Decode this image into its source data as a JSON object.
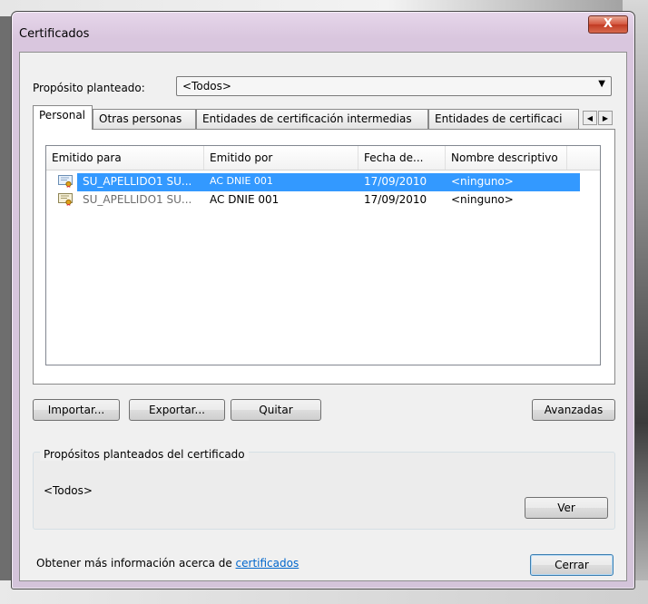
{
  "window": {
    "title": "Certificados",
    "close_glyph": "X"
  },
  "purpose": {
    "label": "Propósito planteado:",
    "value": "<Todos>"
  },
  "tabs": [
    {
      "label": "Personal",
      "active": true
    },
    {
      "label": "Otras personas"
    },
    {
      "label": "Entidades de certificación intermedias"
    },
    {
      "label": "Entidades de certificaci"
    }
  ],
  "list": {
    "columns": [
      "Emitido para",
      "Emitido por",
      "Fecha de...",
      "Nombre descriptivo"
    ],
    "rows": [
      {
        "issued_to": "SU_APELLIDO1 SU...",
        "issued_by": "AC DNIE  001",
        "date": "17/09/2010",
        "friendly": "<ninguno>",
        "selected": true
      },
      {
        "issued_to": "SU_APELLIDO1 SU...",
        "issued_by": "AC DNIE 001",
        "date": "17/09/2010",
        "friendly": "<ninguno>",
        "selected": false
      }
    ]
  },
  "buttons": {
    "import": "Importar...",
    "export": "Exportar...",
    "remove": "Quitar",
    "advanced": "Avanzadas",
    "view": "Ver",
    "close": "Cerrar"
  },
  "purposes_group": {
    "title": "Propósitos planteados del certificado",
    "value": "<Todos>"
  },
  "footer": {
    "text": "Obtener más información acerca de ",
    "link": "certificados"
  },
  "colors": {
    "selection": "#3399ff",
    "link": "#0066cc"
  }
}
